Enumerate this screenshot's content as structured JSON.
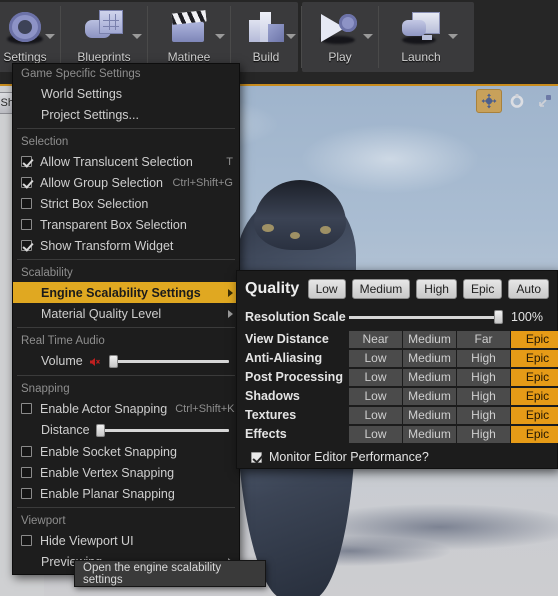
{
  "toolbar": {
    "items": [
      {
        "label": "Settings",
        "icon": "gear-icon",
        "has_arrow": true
      },
      {
        "label": "Blueprints",
        "icon": "blueprint-icon",
        "has_arrow": true
      },
      {
        "label": "Matinee",
        "icon": "clapperboard-icon",
        "has_arrow": true
      },
      {
        "label": "Build",
        "icon": "build-icon",
        "has_arrow": true
      },
      {
        "label": "Play",
        "icon": "play-icon",
        "has_arrow": true
      },
      {
        "label": "Launch",
        "icon": "launch-icon",
        "has_arrow": true
      }
    ]
  },
  "viewport": {
    "left_button_label": "Sh",
    "gizmo_buttons": [
      {
        "name": "translate-gizmo",
        "selected": true
      },
      {
        "name": "rotate-gizmo",
        "selected": false
      },
      {
        "name": "scale-gizmo",
        "selected": false
      }
    ]
  },
  "menu": {
    "sections": [
      {
        "header": "Game Specific Settings",
        "rows": [
          {
            "type": "item",
            "label": "World Settings",
            "shortcut": ""
          },
          {
            "type": "item",
            "label": "Project Settings...",
            "shortcut": ""
          }
        ]
      },
      {
        "header": "Selection",
        "rows": [
          {
            "type": "check",
            "label": "Allow Translucent Selection",
            "shortcut": "T",
            "checked": true
          },
          {
            "type": "check",
            "label": "Allow Group Selection",
            "shortcut": "Ctrl+Shift+G",
            "checked": true
          },
          {
            "type": "check",
            "label": "Strict Box Selection",
            "shortcut": "",
            "checked": false
          },
          {
            "type": "check",
            "label": "Transparent Box Selection",
            "shortcut": "",
            "checked": false
          },
          {
            "type": "check",
            "label": "Show Transform Widget",
            "shortcut": "",
            "checked": true
          }
        ]
      },
      {
        "header": "Scalability",
        "rows": [
          {
            "type": "submenu",
            "label": "Engine Scalability Settings",
            "highlighted": true
          },
          {
            "type": "submenu",
            "label": "Material Quality Level",
            "highlighted": false
          }
        ]
      },
      {
        "header": "Real Time Audio",
        "rows": [
          {
            "type": "slider",
            "label": "Volume",
            "icon": "speaker-muted-icon",
            "fill_percent": 5
          }
        ]
      },
      {
        "header": "Snapping",
        "rows": [
          {
            "type": "check",
            "label": "Enable Actor Snapping",
            "shortcut": "Ctrl+Shift+K",
            "checked": false
          },
          {
            "type": "slider",
            "label": "Distance",
            "icon": "",
            "fill_percent": 2
          },
          {
            "type": "check",
            "label": "Enable Socket Snapping",
            "shortcut": "",
            "checked": false
          },
          {
            "type": "check",
            "label": "Enable Vertex Snapping",
            "shortcut": "",
            "checked": false
          },
          {
            "type": "check",
            "label": "Enable Planar Snapping",
            "shortcut": "",
            "checked": false
          }
        ]
      },
      {
        "header": "Viewport",
        "rows": [
          {
            "type": "check",
            "label": "Hide Viewport UI",
            "shortcut": "",
            "checked": false
          },
          {
            "type": "submenu",
            "label": "Previewing",
            "highlighted": false
          }
        ]
      }
    ]
  },
  "quality_panel": {
    "title": "Quality",
    "presets": [
      "Low",
      "Medium",
      "High",
      "Epic",
      "Auto"
    ],
    "resolution_scale": {
      "label": "Resolution Scale",
      "value": "100%",
      "percent": 100
    },
    "settings": [
      {
        "label": "View Distance",
        "options": [
          "Near",
          "Medium",
          "Far",
          "Epic"
        ],
        "selected": 3
      },
      {
        "label": "Anti-Aliasing",
        "options": [
          "Low",
          "Medium",
          "High",
          "Epic"
        ],
        "selected": 3
      },
      {
        "label": "Post Processing",
        "options": [
          "Low",
          "Medium",
          "High",
          "Epic"
        ],
        "selected": 3
      },
      {
        "label": "Shadows",
        "options": [
          "Low",
          "Medium",
          "High",
          "Epic"
        ],
        "selected": 3
      },
      {
        "label": "Textures",
        "options": [
          "Low",
          "Medium",
          "High",
          "Epic"
        ],
        "selected": 3
      },
      {
        "label": "Effects",
        "options": [
          "Low",
          "Medium",
          "High",
          "Epic"
        ],
        "selected": 3
      }
    ],
    "monitor_performance": {
      "label": "Monitor Editor Performance?",
      "checked": true
    }
  },
  "tooltip": {
    "text": "Open the engine scalability settings"
  },
  "colors": {
    "menu_bg": "#1d1d1d",
    "highlight": "#e0a821",
    "accent_orange": "#e69b17",
    "option_bg": "#4b4b4b",
    "toolbar_bg": "#3a3a3c",
    "viewport_border": "#c88c1e"
  }
}
